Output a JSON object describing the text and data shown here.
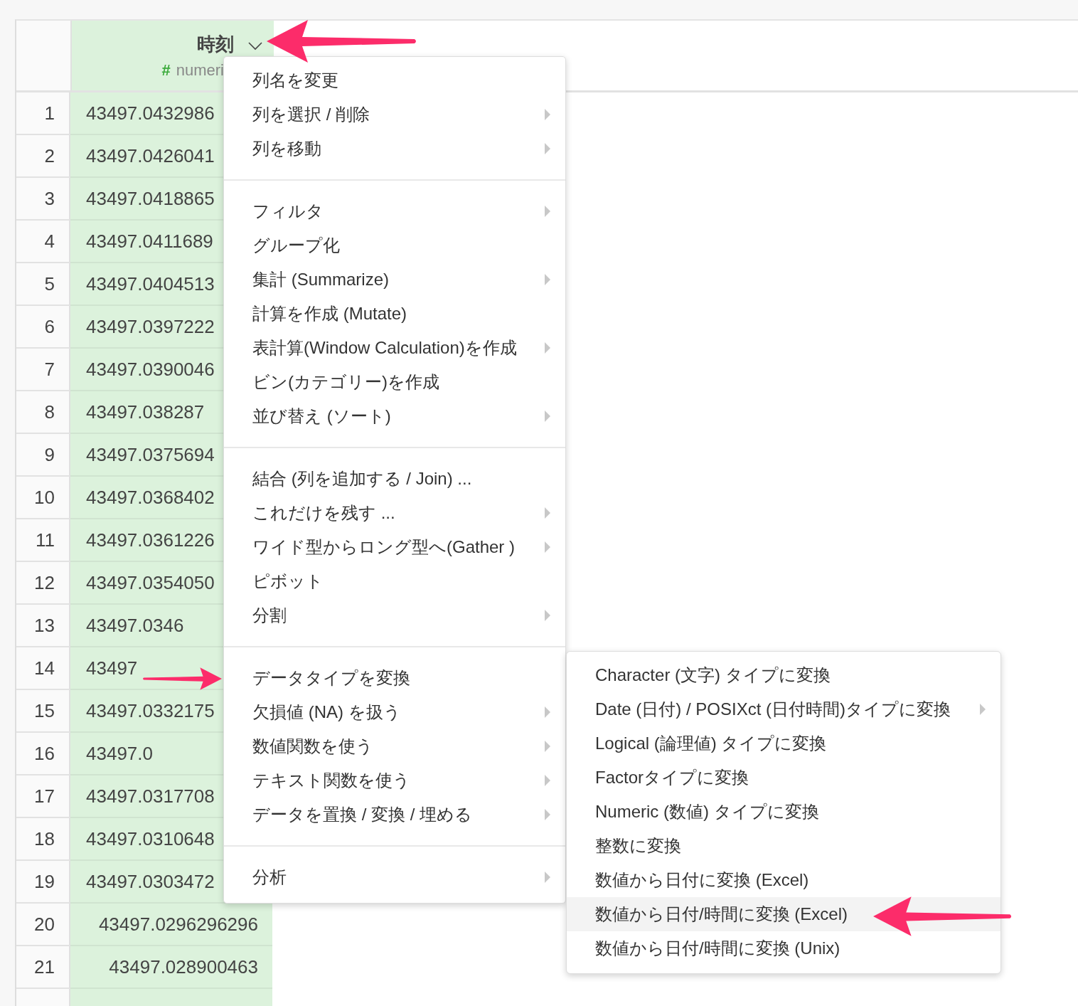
{
  "table": {
    "column": {
      "name": "時刻",
      "type_icon": "#",
      "type": "numeri"
    },
    "rows": [
      {
        "num": "1",
        "value": "43497.0432986",
        "covered": true
      },
      {
        "num": "2",
        "value": "43497.0426041",
        "covered": true
      },
      {
        "num": "3",
        "value": "43497.0418865",
        "covered": true
      },
      {
        "num": "4",
        "value": "43497.0411689",
        "covered": true
      },
      {
        "num": "5",
        "value": "43497.0404513",
        "covered": true
      },
      {
        "num": "6",
        "value": "43497.0397222",
        "covered": true
      },
      {
        "num": "7",
        "value": "43497.0390046",
        "covered": true
      },
      {
        "num": "8",
        "value": "43497.038287",
        "covered": true
      },
      {
        "num": "9",
        "value": "43497.0375694",
        "covered": true
      },
      {
        "num": "10",
        "value": "43497.0368402",
        "covered": true
      },
      {
        "num": "11",
        "value": "43497.0361226",
        "covered": true
      },
      {
        "num": "12",
        "value": "43497.0354050",
        "covered": true
      },
      {
        "num": "13",
        "value": "43497.0346",
        "covered": true
      },
      {
        "num": "14",
        "value": "43497",
        "covered": true
      },
      {
        "num": "15",
        "value": "43497.0332175",
        "covered": true
      },
      {
        "num": "16",
        "value": "43497.0",
        "covered": true
      },
      {
        "num": "17",
        "value": "43497.0317708",
        "covered": true
      },
      {
        "num": "18",
        "value": "43497.0310648",
        "covered": true
      },
      {
        "num": "19",
        "value": "43497.0303472",
        "covered": true
      },
      {
        "num": "20",
        "value": "43497.0296296296",
        "covered": false
      },
      {
        "num": "21",
        "value": "43497.028900463",
        "covered": false
      }
    ]
  },
  "menu": {
    "sections": [
      [
        {
          "label": "列名を変更",
          "submenu": false
        },
        {
          "label": "列を選択 / 削除",
          "submenu": true
        },
        {
          "label": "列を移動",
          "submenu": true
        }
      ],
      [
        {
          "label": "フィルタ",
          "submenu": true
        },
        {
          "label": "グループ化",
          "submenu": false
        },
        {
          "label": "集計 (Summarize)",
          "submenu": true
        },
        {
          "label": "計算を作成 (Mutate)",
          "submenu": false
        },
        {
          "label": "表計算(Window Calculation)を作成",
          "submenu": true
        },
        {
          "label": "ビン(カテゴリー)を作成",
          "submenu": false
        },
        {
          "label": "並び替え (ソート)",
          "submenu": true
        }
      ],
      [
        {
          "label": "結合 (列を追加する / Join) ...",
          "submenu": false
        },
        {
          "label": "これだけを残す ...",
          "submenu": true
        },
        {
          "label": "ワイド型からロング型へ(Gather )",
          "submenu": true
        },
        {
          "label": "ピボット",
          "submenu": false
        },
        {
          "label": "分割",
          "submenu": true
        }
      ],
      [
        {
          "label": "データタイプを変換",
          "submenu": false
        },
        {
          "label": "欠損値 (NA) を扱う",
          "submenu": true
        },
        {
          "label": "数値関数を使う",
          "submenu": true
        },
        {
          "label": "テキスト関数を使う",
          "submenu": true
        },
        {
          "label": "データを置換 / 変換 / 埋める",
          "submenu": true
        }
      ],
      [
        {
          "label": "分析",
          "submenu": true
        }
      ]
    ]
  },
  "submenu": {
    "items": [
      {
        "label": "Character (文字) タイプに変換",
        "submenu": false,
        "selected": false
      },
      {
        "label": "Date (日付) / POSIXct (日付時間)タイプに変換",
        "submenu": true,
        "selected": false
      },
      {
        "label": "Logical (論理値) タイプに変換",
        "submenu": false,
        "selected": false
      },
      {
        "label": "Factorタイプに変換",
        "submenu": false,
        "selected": false
      },
      {
        "label": "Numeric (数値) タイプに変換",
        "submenu": false,
        "selected": false
      },
      {
        "label": "整数に変換",
        "submenu": false,
        "selected": false
      },
      {
        "label": "数値から日付に変換 (Excel)",
        "submenu": false,
        "selected": false
      },
      {
        "label": "数値から日付/時間に変換 (Excel)",
        "submenu": false,
        "selected": true
      },
      {
        "label": "数値から日付/時間に変換 (Unix)",
        "submenu": false,
        "selected": false
      }
    ]
  }
}
